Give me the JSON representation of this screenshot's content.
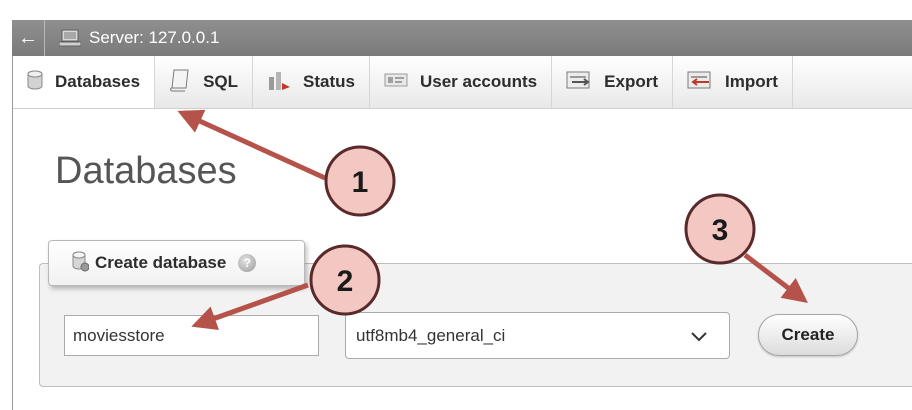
{
  "server_bar": {
    "collapse_symbol": "←",
    "label": "Server: 127.0.0.1"
  },
  "tabs": [
    {
      "label": "Databases",
      "icon": "database-icon",
      "active": true
    },
    {
      "label": "SQL",
      "icon": "sql-icon",
      "active": false
    },
    {
      "label": "Status",
      "icon": "status-icon",
      "active": false
    },
    {
      "label": "User accounts",
      "icon": "user-accounts-icon",
      "active": false
    },
    {
      "label": "Export",
      "icon": "export-icon",
      "active": false
    },
    {
      "label": "Import",
      "icon": "import-icon",
      "active": false
    }
  ],
  "main": {
    "title": "Databases",
    "create_panel": {
      "legend": "Create database",
      "db_name_value": "moviesstore",
      "collation_selected": "utf8mb4_general_ci",
      "create_label": "Create"
    }
  },
  "callouts": [
    {
      "label": "1"
    },
    {
      "label": "2"
    },
    {
      "label": "3"
    }
  ],
  "colors": {
    "callout_fill": "#f4c8c2",
    "callout_stroke": "#5a2a2a",
    "arrow": "#b5534a",
    "server_bar": "#858585"
  }
}
